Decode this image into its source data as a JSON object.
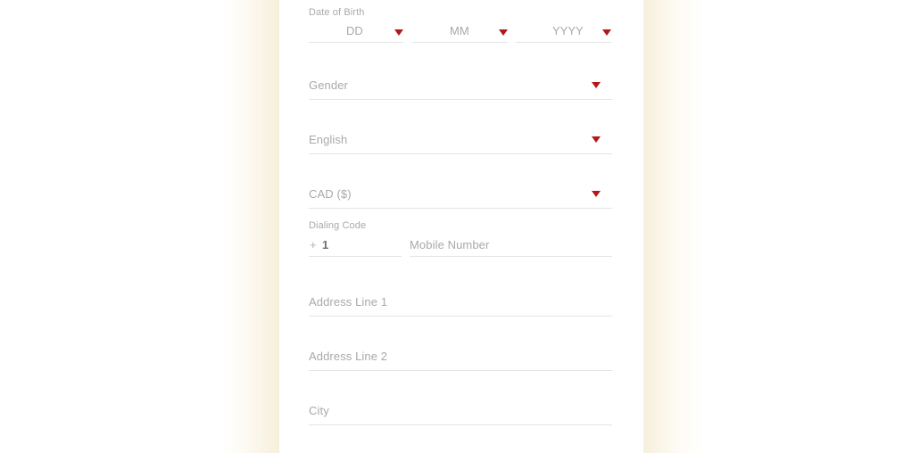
{
  "theme": {
    "accent_red": "#b41717",
    "placeholder_gray": "#a9a9a9",
    "value_gray": "#6f6f6f",
    "underline_gray": "#e4e4e4",
    "card_background": "#ffffff",
    "page_band": "#f7efdc"
  },
  "form": {
    "date_of_birth": {
      "label": "Date of Birth",
      "day_placeholder": "DD",
      "month_placeholder": "MM",
      "year_placeholder": "YYYY",
      "caret_icon": "chevron-down-icon"
    },
    "gender": {
      "placeholder": "Gender",
      "caret_icon": "chevron-down-icon"
    },
    "language": {
      "value": "English",
      "caret_icon": "chevron-down-icon"
    },
    "currency": {
      "value": "CAD ($)",
      "caret_icon": "chevron-down-icon"
    },
    "dialing_code": {
      "label": "Dialing Code",
      "prefix": "+",
      "value": "1"
    },
    "mobile_number": {
      "placeholder": "Mobile Number"
    },
    "address_line_1": {
      "placeholder": "Address Line 1"
    },
    "address_line_2": {
      "placeholder": "Address Line 2"
    },
    "city": {
      "placeholder": "City"
    }
  }
}
